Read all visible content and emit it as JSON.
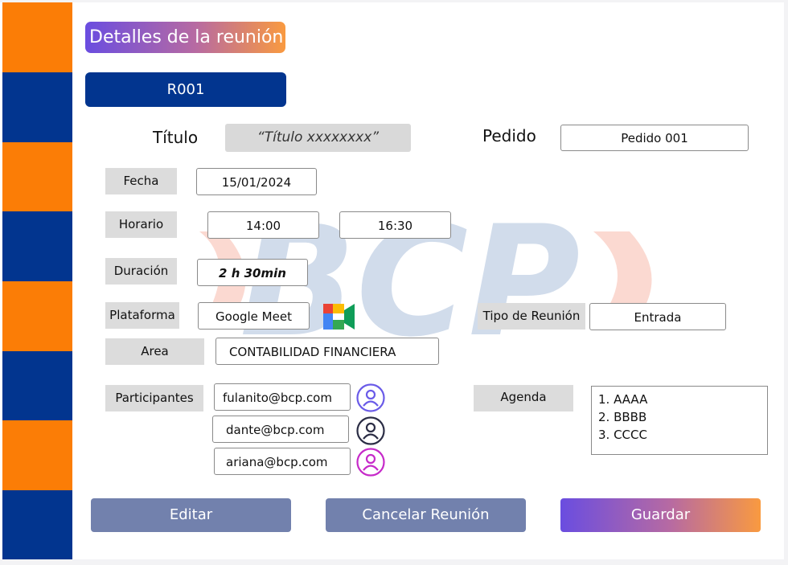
{
  "header": {
    "title": "Detalles de la reunión",
    "meeting_code": "R001"
  },
  "form": {
    "titulo_label": "Título",
    "titulo_value": "“Título xxxxxxxx”",
    "pedido_label": "Pedido",
    "pedido_value": "Pedido 001",
    "fecha_label": "Fecha",
    "fecha_value": "15/01/2024",
    "horario_label": "Horario",
    "horario_start": "14:00",
    "horario_end": "16:30",
    "duracion_label": "Duración",
    "duracion_value": "2 h 30min",
    "plataforma_label": "Plataforma",
    "plataforma_value": "Google Meet",
    "plataforma_icon": "google-meet-icon",
    "tipo_label": "Tipo de Reunión",
    "tipo_value": "Entrada",
    "area_label": "Area",
    "area_value": "CONTABILIDAD FINANCIERA",
    "participantes_label": "Participantes",
    "participants": [
      {
        "email": "fulanito@bcp.com",
        "icon": "user-avatar-icon",
        "color": "#6a5be8"
      },
      {
        "email": "dante@bcp.com",
        "icon": "user-avatar-icon",
        "color": "#2b2d45"
      },
      {
        "email": "ariana@bcp.com",
        "icon": "user-avatar-icon",
        "color": "#c62ac9"
      }
    ],
    "agenda_label": "Agenda",
    "agenda_items": [
      "1. AAAA",
      "2. BBBB",
      "3. CCCC"
    ]
  },
  "watermark": {
    "logo_text": "BCP"
  },
  "actions": {
    "editar": "Editar",
    "cancelar": "Cancelar Reunión",
    "guardar": "Guardar"
  },
  "colors": {
    "orange": "#fb7d06",
    "navy": "#02358f",
    "button_grey": "#7281ad",
    "gradient_start": "#6a4de0",
    "gradient_end": "#f99a40"
  }
}
